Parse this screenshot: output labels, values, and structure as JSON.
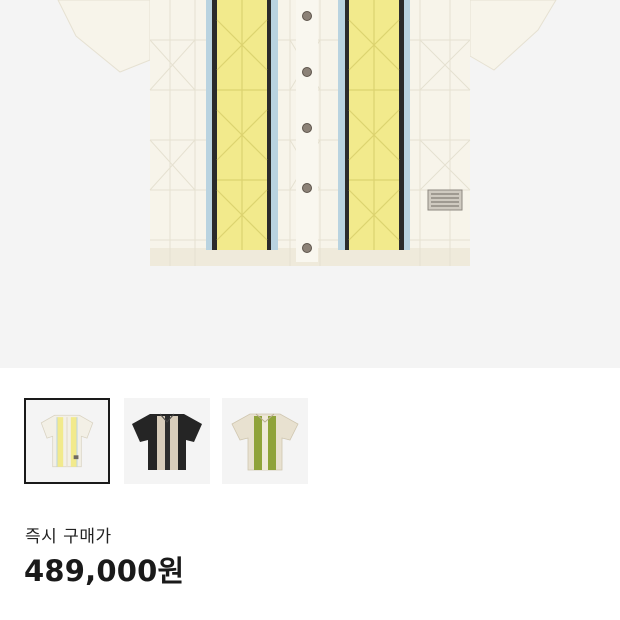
{
  "product": {
    "images": [
      {
        "name": "cream-yellow-knit-shirt",
        "colors": [
          "#f3f0e6",
          "#f2ea8c",
          "#b9d3e0"
        ],
        "selected": true
      },
      {
        "name": "black-beige-knit-shirt",
        "colors": [
          "#252525",
          "#d8cdbb",
          "#3a3a3a"
        ],
        "selected": false
      },
      {
        "name": "beige-green-knit-shirt",
        "colors": [
          "#e8e1d0",
          "#8fa33a",
          "#c9c08a"
        ],
        "selected": false
      }
    ]
  },
  "pricing": {
    "label": "즉시 구매가",
    "amount": "489,000원"
  }
}
